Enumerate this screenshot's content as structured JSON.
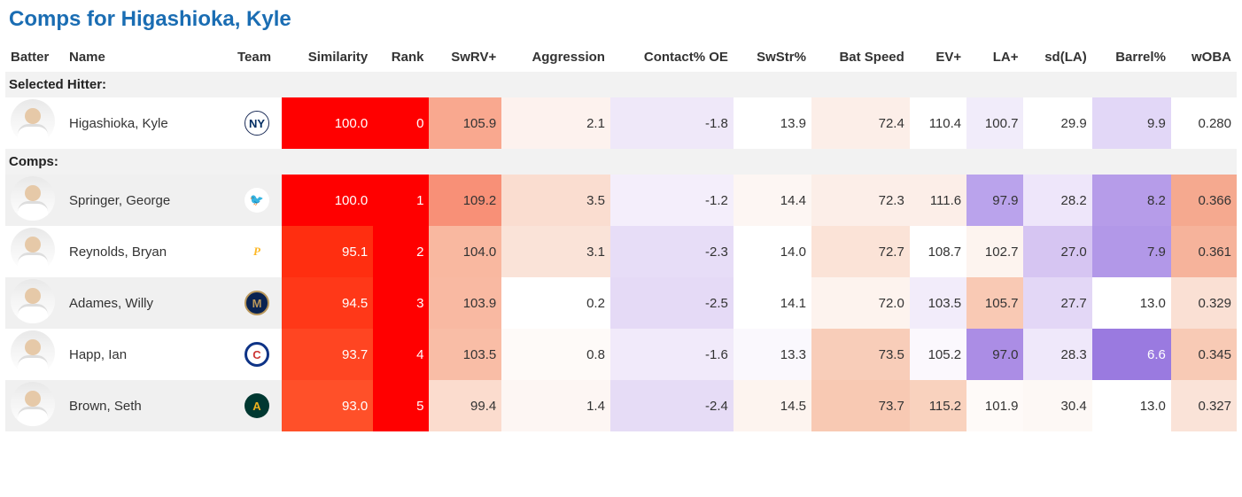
{
  "title": "Comps for Higashioka, Kyle",
  "columns": [
    "Batter",
    "Name",
    "Team",
    "Similarity",
    "Rank",
    "SwRV+",
    "Aggression",
    "Contact% OE",
    "SwStr%",
    "Bat Speed",
    "EV+",
    "LA+",
    "sd(LA)",
    "Barrel%",
    "wOBA"
  ],
  "section_selected": "Selected Hitter:",
  "section_comps": "Comps:",
  "rows": [
    {
      "name": "Higashioka, Kyle",
      "team_style": "background:#fff; color:#002d62; border:1px solid #1a2b56;",
      "team_abbrev": "NY",
      "cells": [
        {
          "v": "100.0",
          "bg": "#ff0000",
          "tc": "#fff"
        },
        {
          "v": "0",
          "bg": "#ff0000",
          "tc": "#fff"
        },
        {
          "v": "105.9",
          "bg": "#f9a88f"
        },
        {
          "v": "2.1",
          "bg": "#fdf2ee"
        },
        {
          "v": "-1.8",
          "bg": "#efe8f9"
        },
        {
          "v": "13.9",
          "bg": "#ffffff"
        },
        {
          "v": "72.4",
          "bg": "#fceee8"
        },
        {
          "v": "110.4",
          "bg": "#ffffff"
        },
        {
          "v": "100.7",
          "bg": "#f1ecfa"
        },
        {
          "v": "29.9",
          "bg": "#ffffff"
        },
        {
          "v": "9.9",
          "bg": "#e2d7f7"
        },
        {
          "v": "0.280",
          "bg": "#ffffff"
        }
      ]
    },
    {
      "name": "Springer, George",
      "team_style": "background:#fff; color:#134a8e;",
      "team_abbrev": "🐦",
      "cells": [
        {
          "v": "100.0",
          "bg": "#ff0000",
          "tc": "#fff"
        },
        {
          "v": "1",
          "bg": "#ff0000",
          "tc": "#fff"
        },
        {
          "v": "109.2",
          "bg": "#f89077"
        },
        {
          "v": "3.5",
          "bg": "#faddd0"
        },
        {
          "v": "-1.2",
          "bg": "#f4eefb"
        },
        {
          "v": "14.4",
          "bg": "#fdf6f3"
        },
        {
          "v": "72.3",
          "bg": "#fceee8"
        },
        {
          "v": "111.6",
          "bg": "#fceee8"
        },
        {
          "v": "97.9",
          "bg": "#baa3ec"
        },
        {
          "v": "28.2",
          "bg": "#eee6fa"
        },
        {
          "v": "8.2",
          "bg": "#b69ce9"
        },
        {
          "v": "0.366",
          "bg": "#f5a98f"
        }
      ]
    },
    {
      "name": "Reynolds, Bryan",
      "team_style": "background:#fff; color:#fdb827; font-family:Georgia,serif; font-style:italic;",
      "team_abbrev": "P",
      "cells": [
        {
          "v": "95.1",
          "bg": "#ff2e10",
          "tc": "#fff"
        },
        {
          "v": "2",
          "bg": "#ff0000",
          "tc": "#fff"
        },
        {
          "v": "104.0",
          "bg": "#f9b8a0"
        },
        {
          "v": "3.1",
          "bg": "#fae3d8"
        },
        {
          "v": "-2.3",
          "bg": "#e7ddf7"
        },
        {
          "v": "14.0",
          "bg": "#ffffff"
        },
        {
          "v": "72.7",
          "bg": "#fbe3d7"
        },
        {
          "v": "108.7",
          "bg": "#ffffff"
        },
        {
          "v": "102.7",
          "bg": "#fdf4ef"
        },
        {
          "v": "27.0",
          "bg": "#d6c5f2"
        },
        {
          "v": "7.9",
          "bg": "#b298e8"
        },
        {
          "v": "0.361",
          "bg": "#f6b39b"
        }
      ]
    },
    {
      "name": "Adames, Willy",
      "team_style": "background:#0a2351; color:#b9975b; border:2px solid #b9975b;",
      "team_abbrev": "M",
      "cells": [
        {
          "v": "94.5",
          "bg": "#ff3818",
          "tc": "#fff"
        },
        {
          "v": "3",
          "bg": "#ff0000",
          "tc": "#fff"
        },
        {
          "v": "103.9",
          "bg": "#f9b9a2"
        },
        {
          "v": "0.2",
          "bg": "#ffffff"
        },
        {
          "v": "-2.5",
          "bg": "#e5daf6"
        },
        {
          "v": "14.1",
          "bg": "#ffffff"
        },
        {
          "v": "72.0",
          "bg": "#fdf3ee"
        },
        {
          "v": "103.5",
          "bg": "#f2ecfa"
        },
        {
          "v": "105.7",
          "bg": "#f9c9b4"
        },
        {
          "v": "27.7",
          "bg": "#e3d7f6"
        },
        {
          "v": "13.0",
          "bg": "#ffffff"
        },
        {
          "v": "0.329",
          "bg": "#fae0d4"
        }
      ]
    },
    {
      "name": "Happ, Ian",
      "team_style": "background:#fff; color:#cc3433; border:3px solid #0e3386;",
      "team_abbrev": "C",
      "cells": [
        {
          "v": "93.7",
          "bg": "#ff4522",
          "tc": "#fff"
        },
        {
          "v": "4",
          "bg": "#ff0000",
          "tc": "#fff"
        },
        {
          "v": "103.5",
          "bg": "#f9bda6"
        },
        {
          "v": "0.8",
          "bg": "#fefaf8"
        },
        {
          "v": "-1.6",
          "bg": "#f1eafa"
        },
        {
          "v": "13.3",
          "bg": "#faf8fd"
        },
        {
          "v": "73.5",
          "bg": "#f8cdb9"
        },
        {
          "v": "105.2",
          "bg": "#fbf8fd"
        },
        {
          "v": "97.0",
          "bg": "#ab8de5"
        },
        {
          "v": "28.3",
          "bg": "#efe8fa"
        },
        {
          "v": "6.6",
          "bg": "#9a7ae0",
          "tc": "#fff"
        },
        {
          "v": "0.345",
          "bg": "#f8cab5"
        }
      ]
    },
    {
      "name": "Brown, Seth",
      "team_style": "background:#003831; color:#efb21e;",
      "team_abbrev": "A",
      "cells": [
        {
          "v": "93.0",
          "bg": "#ff5029",
          "tc": "#fff"
        },
        {
          "v": "5",
          "bg": "#ff0000",
          "tc": "#fff"
        },
        {
          "v": "99.4",
          "bg": "#fbdcce"
        },
        {
          "v": "1.4",
          "bg": "#fdf6f3"
        },
        {
          "v": "-2.4",
          "bg": "#e6dcf6"
        },
        {
          "v": "14.5",
          "bg": "#fdf4ef"
        },
        {
          "v": "73.7",
          "bg": "#f8c9b3"
        },
        {
          "v": "115.2",
          "bg": "#f9d2be"
        },
        {
          "v": "101.9",
          "bg": "#fefaf8"
        },
        {
          "v": "30.4",
          "bg": "#fdf8f5"
        },
        {
          "v": "13.0",
          "bg": "#ffffff"
        },
        {
          "v": "0.327",
          "bg": "#fae3d8"
        }
      ]
    }
  ]
}
